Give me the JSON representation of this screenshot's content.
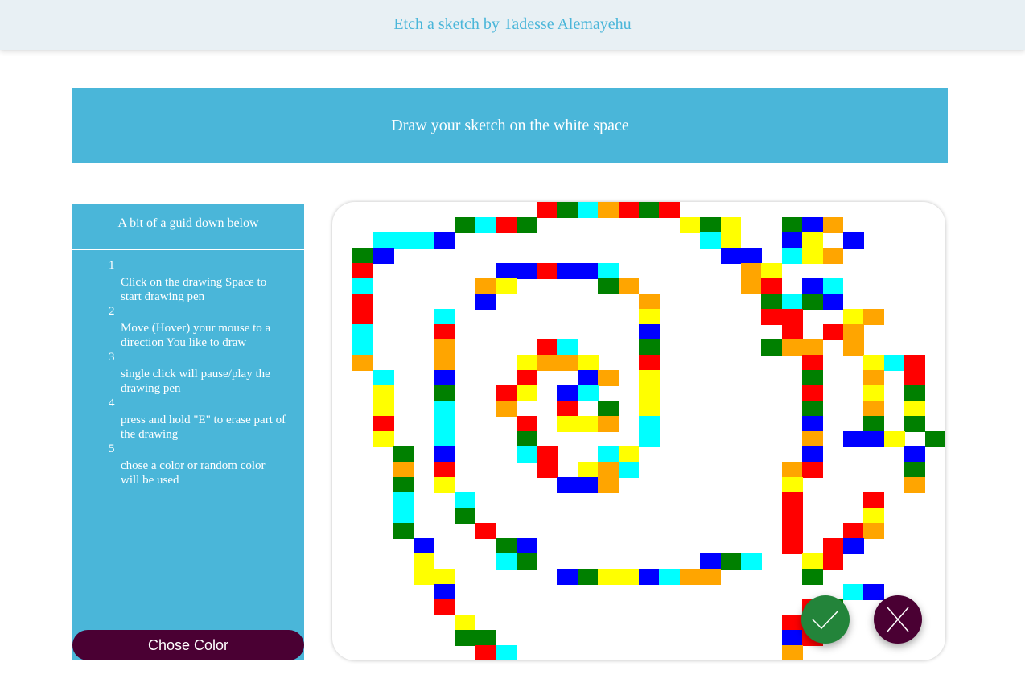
{
  "header": {
    "title": "Etch a sketch by Tadesse Alemayehu"
  },
  "banner": {
    "text": "Draw your sketch on the white space"
  },
  "guide": {
    "title": "A bit of a guid down below",
    "steps": [
      {
        "num": "1",
        "text": "Click on the drawing Space to start drawing pen"
      },
      {
        "num": "2",
        "text": "Move (Hover) your mouse to a direction You like to draw"
      },
      {
        "num": "3",
        "text": "single click will pause/play the drawing pen"
      },
      {
        "num": "4",
        "text": "press and hold \"E\" to erase part of the drawing"
      },
      {
        "num": "5",
        "text": "chose a color or random color will be used"
      }
    ]
  },
  "color_button": {
    "label": "Chose Color"
  },
  "actions": {
    "confirm_icon": "check-icon",
    "close_icon": "close-icon"
  },
  "colors": {
    "accent": "#4ab6d9",
    "button": "#4a0033",
    "confirm": "#23843a",
    "palette": {
      "R": "#ff0000",
      "G": "#008000",
      "B": "#0000ff",
      "C": "#00ffff",
      "Y": "#ffff00",
      "O": "#ffa500"
    }
  },
  "sketch": {
    "cols": 30,
    "rows": 30,
    "cells": [
      "..........RGCORGR.............",
      "......GCRG.......YGY..GBO.....",
      "..CCCB............CY..BY.B....",
      ".GB................BB.CYO.....",
      ".R......BBRBBC......OY........",
      ".C.....OY....GO.....OR.BC.....",
      ".R.....B.......O.....GCGB.....",
      ".R...C.........Y.....RR..YO...",
      ".C...R.........B......R.RO....",
      ".C...O....RC...G.....GOO.O....",
      ".O...O...YOOY..R.......R..YCR.",
      "..C..B...R..BO.Y.......G..O.R.",
      "..Y..G..RY.BC..Y.......R..Y.G.",
      "..Y..C..O..R.G.Y.......G..O.Y.",
      "..R..C...R.YYO.C.......B..G.G.",
      "..Y..C...G.....C.......O.BBY.G",
      "...G.B...CR..CY........B....B.",
      "...O.R....R.YOC.......OR....G.",
      "...G.Y.....BBO........Y.....O.",
      "...C..C...............R...R...",
      "...C..G...............R...Y...",
      "...G...R..............R..RO...",
      "....B...GB............R.RB....",
      "....Y...CG........BGC..YR.....",
      "....YY.....BGYYBCOO....G......",
      ".....B...................CB...",
      ".....R.................RG.....",
      "......Y...............RR......",
      "......GG..............BR......",
      ".......RC.............O......."
    ]
  }
}
